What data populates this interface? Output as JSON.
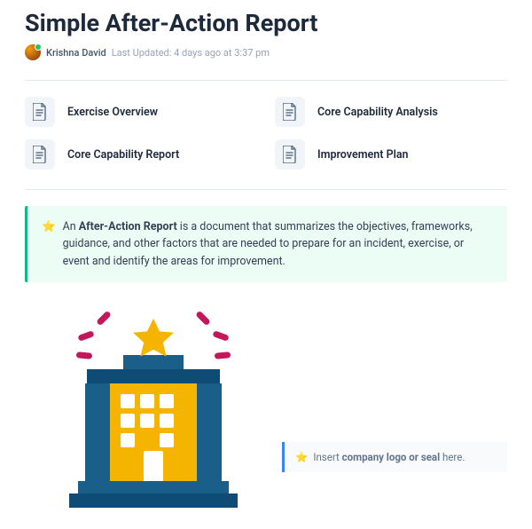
{
  "title": "Simple After-Action Report",
  "author": "Krishna David",
  "last_updated": "Last Updated: 4 days ago at 3:37 pm",
  "toc": [
    {
      "label": "Exercise Overview"
    },
    {
      "label": "Core Capability Analysis"
    },
    {
      "label": "Core Capability Report"
    },
    {
      "label": "Improvement Plan"
    }
  ],
  "callout": {
    "prefix": "An ",
    "bold": "After-Action Report",
    "rest": " is a document that summarizes the objectives, frameworks, guidance, and other factors that are needed to prepare for an incident, exercise, or event and identify the areas for improvement."
  },
  "logo_prompt": {
    "prefix": "Insert ",
    "bold": "company logo or seal",
    "rest": " here."
  }
}
